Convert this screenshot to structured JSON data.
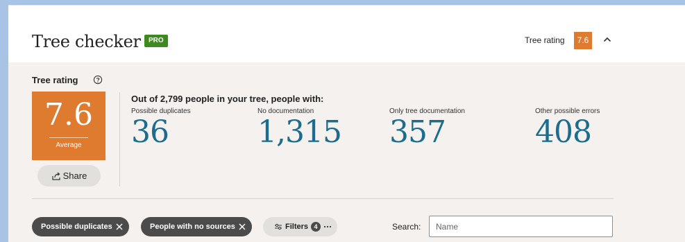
{
  "header": {
    "title": "Tree checker",
    "badge": "PRO",
    "rating_label": "Tree rating",
    "rating_value": "7.6",
    "collapse_icon": "chevron-up-icon"
  },
  "rating": {
    "label": "Tree rating",
    "help_icon": "question-circle-icon",
    "score": "7.6",
    "caption": "Average",
    "share_label": "Share",
    "share_icon": "share-icon"
  },
  "summary": {
    "heading": "Out of 2,799 people in your tree, people with:",
    "stats": [
      {
        "label": "Possible duplicates",
        "value": "36"
      },
      {
        "label": "No documentation",
        "value": "1,315"
      },
      {
        "label": "Only tree documentation",
        "value": "357"
      },
      {
        "label": "Other possible errors",
        "value": "408"
      }
    ]
  },
  "filters": {
    "chips": [
      {
        "label": "Possible duplicates"
      },
      {
        "label": "People with no sources"
      }
    ],
    "filters_label": "Filters",
    "filters_count": "4",
    "search_label": "Search:",
    "search_placeholder": "Name"
  },
  "colors": {
    "accent_orange": "#de7b2e",
    "stat_blue": "#1c6c8e",
    "pro_green": "#3d8a1f",
    "chip_dark": "#4b4b4b"
  }
}
